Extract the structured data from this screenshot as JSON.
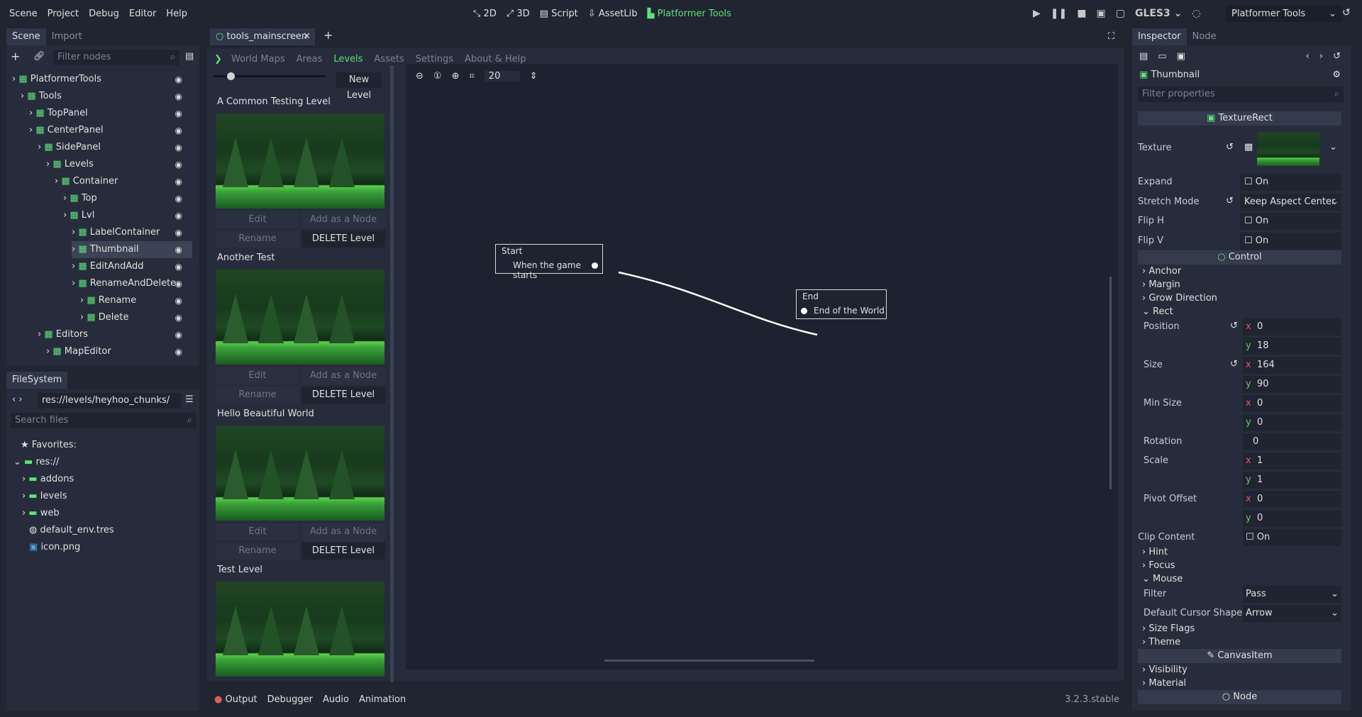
{
  "menu": [
    "Scene",
    "Project",
    "Debug",
    "Editor",
    "Help"
  ],
  "modes": {
    "m2d": "2D",
    "m3d": "3D",
    "script": "Script",
    "assetlib": "AssetLib",
    "plugin": "Platformer Tools"
  },
  "renderer": "GLES3",
  "project_select": "Platformer Tools",
  "scene_panel": {
    "tabs": [
      "Scene",
      "Import"
    ],
    "filter_placeholder": "Filter nodes",
    "nodes": [
      {
        "label": "PlatformerTools",
        "depth": 0
      },
      {
        "label": "Tools",
        "depth": 1
      },
      {
        "label": "TopPanel",
        "depth": 2
      },
      {
        "label": "CenterPanel",
        "depth": 2
      },
      {
        "label": "SidePanel",
        "depth": 3
      },
      {
        "label": "Levels",
        "depth": 4
      },
      {
        "label": "Container",
        "depth": 5
      },
      {
        "label": "Top",
        "depth": 6
      },
      {
        "label": "Lvl",
        "depth": 6
      },
      {
        "label": "LabelContainer",
        "depth": 7
      },
      {
        "label": "Thumbnail",
        "depth": 7
      },
      {
        "label": "EditAndAdd",
        "depth": 7
      },
      {
        "label": "RenameAndDelete",
        "depth": 7
      },
      {
        "label": "Rename",
        "depth": 8
      },
      {
        "label": "Delete",
        "depth": 8
      },
      {
        "label": "Editors",
        "depth": 3
      },
      {
        "label": "MapEditor",
        "depth": 4
      }
    ]
  },
  "filesystem": {
    "tab": "FileSystem",
    "path": "res://levels/heyhoo_chunks/",
    "search_placeholder": "Search files",
    "items": [
      "Favorites:",
      "res://",
      "addons",
      "levels",
      "web",
      "default_env.tres",
      "icon.png"
    ]
  },
  "editor_tab": "tools_mainscreen",
  "plugin_tabs": [
    "World Maps",
    "Areas",
    "Levels",
    "Assets",
    "Settings",
    "About & Help"
  ],
  "levels": {
    "new_level": "New Level",
    "edit": "Edit",
    "add_node": "Add as a Node",
    "rename": "Rename",
    "delete": "DELETE Level",
    "list": [
      "A Common Testing Level",
      "Another Test",
      "Hello Beautiful World",
      "Test Level"
    ]
  },
  "graph": {
    "zoom": "20",
    "start_title": "Start",
    "start_port": "When the game starts",
    "end_title": "End",
    "end_port": "End of the World"
  },
  "bottom_tabs": [
    "Output",
    "Debugger",
    "Audio",
    "Animation"
  ],
  "version": "3.2.3.stable",
  "inspector": {
    "tabs": [
      "Inspector",
      "Node"
    ],
    "node_name": "Thumbnail",
    "filter_placeholder": "Filter properties",
    "class_name": "TextureRect",
    "texture": "Texture",
    "expand": "Expand",
    "on": "On",
    "stretch_mode": "Stretch Mode",
    "stretch_value": "Keep Aspect Center",
    "flip_h": "Flip H",
    "flip_v": "Flip V",
    "control": "Control",
    "groups": [
      "Anchor",
      "Margin",
      "Grow Direction",
      "Rect"
    ],
    "position": "Position",
    "pos_x": "0",
    "pos_y": "18",
    "size": "Size",
    "size_x": "164",
    "size_y": "90",
    "min_size": "Min Size",
    "min_x": "0",
    "min_y": "0",
    "rotation": "Rotation",
    "rot": "0",
    "scale": "Scale",
    "scale_x": "1",
    "scale_y": "1",
    "pivot": "Pivot Offset",
    "piv_x": "0",
    "piv_y": "0",
    "clip": "Clip Content",
    "groups2": [
      "Hint",
      "Focus",
      "Mouse"
    ],
    "filter": "Filter",
    "filter_val": "Pass",
    "cursor": "Default Cursor Shape",
    "cursor_val": "Arrow",
    "groups3": [
      "Size Flags",
      "Theme"
    ],
    "canvas": "CanvasItem",
    "groups4": [
      "Visibility",
      "Material"
    ],
    "node": "Node"
  }
}
